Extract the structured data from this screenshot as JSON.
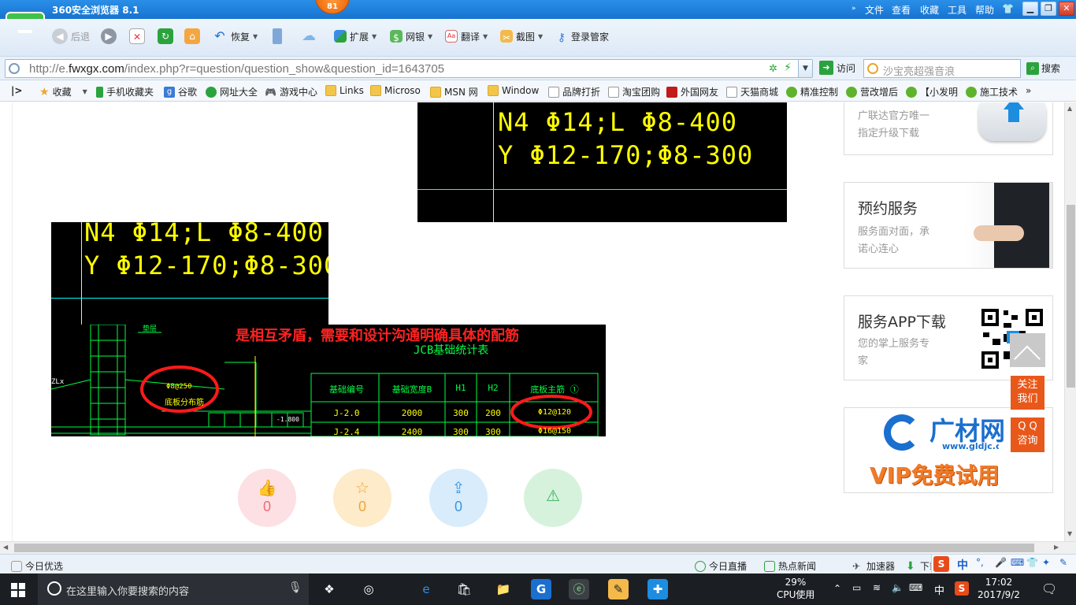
{
  "titlebar": {
    "title": "360安全浏览器 8.1",
    "badge": "81",
    "menu": [
      "文件",
      "查看",
      "收藏",
      "工具",
      "帮助"
    ],
    "controls": [
      "minimize",
      "restore",
      "close"
    ]
  },
  "toolbar": {
    "back": "后退",
    "restore": "恢复",
    "extend": "扩展",
    "netbank": "网银",
    "translate": "翻译",
    "screenshot": "截图",
    "login_manager": "登录管家"
  },
  "address": {
    "url_prefix": "http://e.",
    "url_domain": "fwxgx.com",
    "url_rest": "/index.php?r=question/question_show&question_id=1643705",
    "visit": "访问",
    "search_placeholder": "沙宝亮超强音浪",
    "search_button": "搜索"
  },
  "bookmarks": [
    {
      "label": "收藏",
      "icon": "star-icon"
    },
    {
      "label": "手机收藏夹",
      "icon": "phone-icon"
    },
    {
      "label": "谷歌",
      "icon": "google-icon"
    },
    {
      "label": "网址大全",
      "icon": "web-directory-icon"
    },
    {
      "label": "游戏中心",
      "icon": "gamepad-icon"
    },
    {
      "label": "Links",
      "icon": "folder-icon"
    },
    {
      "label": "Microso",
      "icon": "folder-icon"
    },
    {
      "label": "MSN 网",
      "icon": "folder-icon"
    },
    {
      "label": "Window",
      "icon": "folder-icon"
    },
    {
      "label": "品牌打折",
      "icon": "page-icon"
    },
    {
      "label": "淘宝团购",
      "icon": "page-icon"
    },
    {
      "label": "外国网友",
      "icon": "red-flag-icon"
    },
    {
      "label": "天猫商城",
      "icon": "page-icon"
    },
    {
      "label": "精准控制",
      "icon": "chat-bubble-icon"
    },
    {
      "label": "营改增后",
      "icon": "chat-bubble-icon"
    },
    {
      "label": "【小发明",
      "icon": "chat-bubble-icon"
    },
    {
      "label": "施工技术",
      "icon": "chat-bubble-icon"
    }
  ],
  "cad": {
    "line1": "N4 Φ14;L Φ8-400",
    "line2": "Y Φ12-170;Φ8-300",
    "annotation": "是相互矛盾，需要和设计沟通明确具体的配筋",
    "table_title": "JCB基础统计表",
    "table_headers": [
      "基础编号",
      "基础宽度B",
      "H1",
      "H2",
      "底板主筋 ①"
    ],
    "table_row": [
      "J-2.0",
      "2000",
      "300",
      "200",
      "Φ12@120"
    ],
    "table_row2": [
      "J-2.4",
      "2400",
      "300",
      "300",
      "Φ16@150"
    ],
    "left_labels": {
      "spec": "Φ8@250",
      "desc": "底板分布筋",
      "elev": "-1.800",
      "zl": "ZLx",
      "top": "垫层"
    }
  },
  "stats": [
    {
      "icon": "thumbs-up-icon",
      "count": "0",
      "color": "#f06a7a"
    },
    {
      "icon": "star-icon",
      "count": "0",
      "color": "#f0a53a"
    },
    {
      "icon": "share-icon",
      "count": "0",
      "color": "#3a98e0"
    },
    {
      "icon": "warning-icon",
      "count": "",
      "color": "#3aad5a"
    }
  ],
  "sidebar": {
    "card1_desc": [
      "广联达官方唯一",
      "指定升级下载"
    ],
    "card2_title": "预约服务",
    "card2_desc": [
      "服务面对面，承",
      "诺心连心"
    ],
    "card3_title": "服务APP下载",
    "card3_desc": [
      "您的掌上服务专",
      "家"
    ],
    "ad_brand": "广材网",
    "ad_url": "www.gldjc.com",
    "ad_slogan": "VIP免费试用"
  },
  "floating": {
    "follow": [
      "关注",
      "我们"
    ],
    "qq": [
      "Q Q",
      "咨询"
    ]
  },
  "statusbar": {
    "left": "今日优选",
    "live": "今日直播",
    "news": "热点新闻",
    "accelerator": "加速器",
    "download": "下载",
    "ime": "中"
  },
  "taskbar": {
    "search_placeholder": "在这里输入你要搜索的内容",
    "cpu_percent": "29%",
    "cpu_label": "CPU使用",
    "ime": "中",
    "time": "17:02",
    "date": "2017/9/2"
  }
}
